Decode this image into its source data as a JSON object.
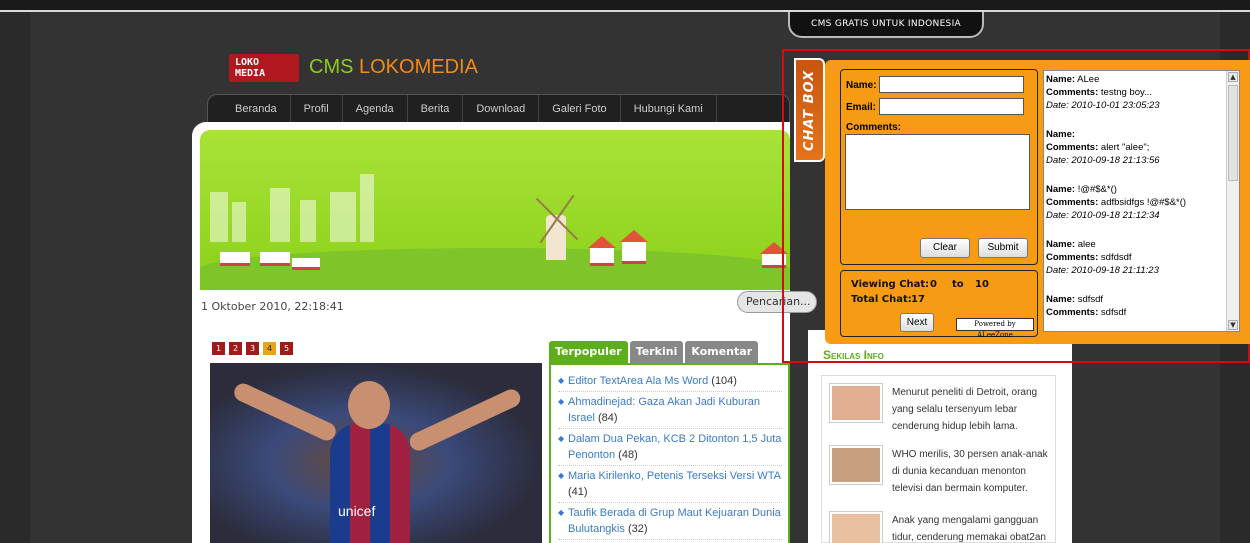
{
  "top_tab": "CMS GRATIS UNTUK INDONESIA",
  "logo": {
    "line1": "LOKO",
    "line2": "MEDIA"
  },
  "brand": {
    "part1": "CMS ",
    "part2": "LOKOMEDIA"
  },
  "nav": [
    "Beranda",
    "Profil",
    "Agenda",
    "Berita",
    "Download",
    "Galeri Foto",
    "Hubungi Kami"
  ],
  "date": "1 Oktober 2010, 22:18:41",
  "search_placeholder": "Pencarian...",
  "pages": [
    "1",
    "2",
    "3",
    "4",
    "5"
  ],
  "photo_text": "unicef",
  "tabs": [
    "Terpopuler",
    "Terkini",
    "Komentar"
  ],
  "popular": [
    {
      "title": "Editor TextArea Ala Ms Word",
      "count": "(104)"
    },
    {
      "title": "Ahmadinejad: Gaza Akan Jadi Kuburan Israel",
      "count": "(84)"
    },
    {
      "title": "Dalam Dua Pekan, KCB 2 Ditonton 1,5 Juta Penonton",
      "count": "(48)"
    },
    {
      "title": "Maria Kirilenko, Petenis Terseksi Versi WTA",
      "count": "(41)"
    },
    {
      "title": "Taufik Berada di Grup Maut Kejuaran Dunia Bulutangkis",
      "count": "(32)"
    }
  ],
  "sekilas": {
    "title": "Sekilas Info",
    "items": [
      "Menurut peneliti di Detroit, orang yang selalu tersenyum lebar cenderung hidup lebih lama.",
      "WHO merilis, 30 persen anak-anak di dunia kecanduan menonton televisi dan bermain komputer.",
      "Anak yang mengalami gangguan tidur, cenderung memakai obat2an"
    ]
  },
  "chat": {
    "tab": "CHAT BOX",
    "name_label": "Name:",
    "email_label": "Email:",
    "comments_label": "Comments:",
    "clear": "Clear",
    "submit": "Submit",
    "viewing": "Viewing Chat:",
    "from": "0",
    "to": "to",
    "upto": "10",
    "total_label": "Total Chat:",
    "total": "17",
    "next": "Next",
    "powered": "Powered by ALeeZone",
    "entries": [
      {
        "name": "ALee",
        "comments": "testng boy...",
        "date": "2010-10-01 23:05:23"
      },
      {
        "name": "",
        "comments": "alert \"alee\";",
        "date": "2010-09-18 21:13:56"
      },
      {
        "name": "!@#$&*()",
        "comments": "adfbsidfgs !@#$&*()",
        "date": "2010-09-18 21:12:34"
      },
      {
        "name": "alee",
        "comments": "sdfdsdf",
        "date": "2010-09-18 21:11:23"
      },
      {
        "name": "sdfsdf",
        "comments": "sdfsdf",
        "date": ""
      }
    ],
    "name_key": "Name:",
    "comments_key": "Comments:",
    "date_key": "Date:"
  }
}
